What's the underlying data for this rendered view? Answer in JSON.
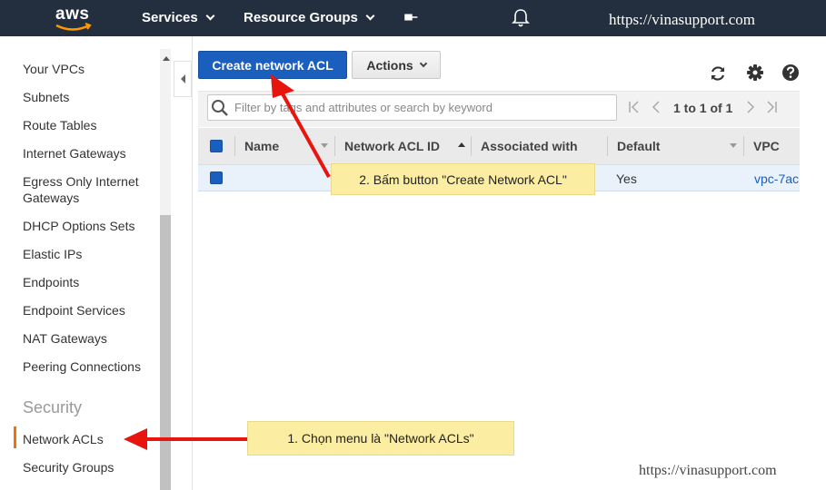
{
  "topnav": {
    "logo_text": "aws",
    "services_label": "Services",
    "resource_groups_label": "Resource Groups",
    "site_url": "https://vinasupport.com"
  },
  "sidebar": {
    "items": [
      {
        "label": "Your VPCs"
      },
      {
        "label": "Subnets"
      },
      {
        "label": "Route Tables"
      },
      {
        "label": "Internet Gateways"
      },
      {
        "label": "Egress Only Internet Gateways"
      },
      {
        "label": "DHCP Options Sets"
      },
      {
        "label": "Elastic IPs"
      },
      {
        "label": "Endpoints"
      },
      {
        "label": "Endpoint Services"
      },
      {
        "label": "NAT Gateways"
      },
      {
        "label": "Peering Connections"
      }
    ],
    "security_header": "Security",
    "security_items": [
      {
        "label": "Network ACLs",
        "active": true
      },
      {
        "label": "Security Groups"
      }
    ]
  },
  "toolbar": {
    "create_label": "Create network ACL",
    "actions_label": "Actions"
  },
  "filter": {
    "placeholder": "Filter by tags and attributes or search by keyword",
    "pagination": "1 to 1 of 1"
  },
  "table": {
    "columns": [
      "Name",
      "Network ACL ID",
      "Associated with",
      "Default",
      "VPC"
    ],
    "rows": [
      {
        "name": "",
        "acl_id": "",
        "associated": "",
        "default": "Yes",
        "vpc": "vpc-7ac"
      }
    ]
  },
  "annotations": {
    "step1": "1. Chọn menu là \"Network ACLs\"",
    "step2": "2. Bấm button \"Create Network ACL\"",
    "arrow_color": "#e8150f"
  },
  "watermark": "https://vinasupport.com",
  "colors": {
    "nav_bg": "#232f3e",
    "primary": "#1a5fbd",
    "accent": "#ec7211",
    "callout_bg": "#fbeea3"
  }
}
